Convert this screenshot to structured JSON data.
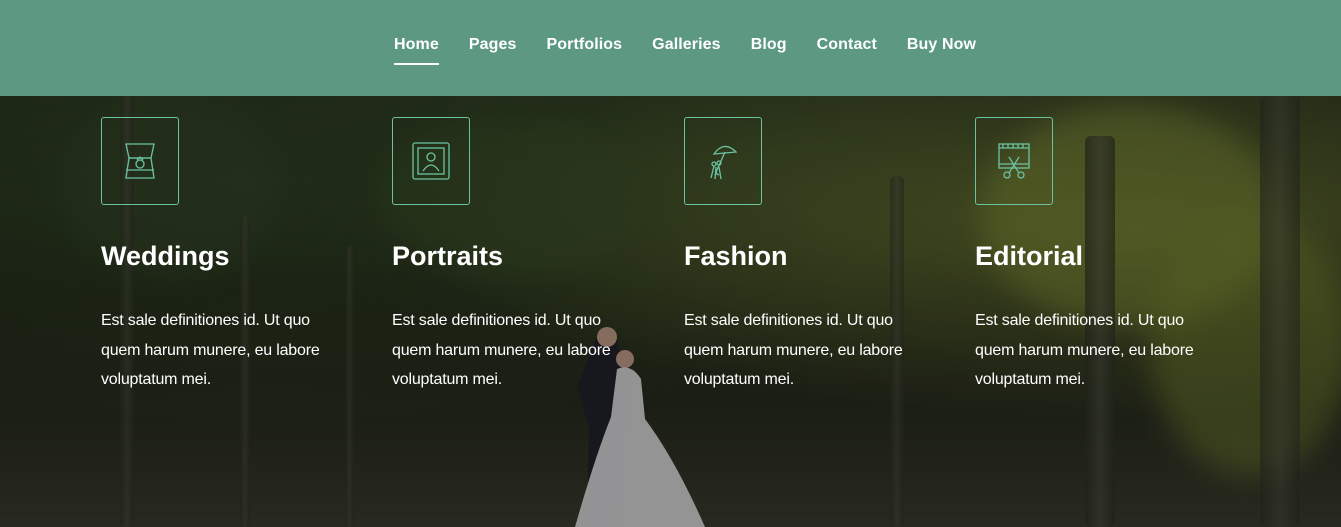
{
  "nav": {
    "items": [
      {
        "label": "Home",
        "active": true
      },
      {
        "label": "Pages",
        "active": false
      },
      {
        "label": "Portfolios",
        "active": false
      },
      {
        "label": "Galleries",
        "active": false
      },
      {
        "label": "Blog",
        "active": false
      },
      {
        "label": "Contact",
        "active": false
      },
      {
        "label": "Buy Now",
        "active": false
      }
    ]
  },
  "colors": {
    "header_bg": "#5c9882",
    "icon_border": "#6cc3a2",
    "text": "#ffffff"
  },
  "services": [
    {
      "icon": "ring-box-icon",
      "title": "Weddings",
      "text": "Est sale definitiones id. Ut quo quem harum munere, eu labore voluptatum mei."
    },
    {
      "icon": "portrait-frame-icon",
      "title": "Portraits",
      "text": "Est sale definitiones id. Ut quo quem harum munere, eu labore voluptatum mei."
    },
    {
      "icon": "umbrella-bouquet-icon",
      "title": "Fashion",
      "text": "Est sale definitiones id. Ut quo quem harum munere, eu labore voluptatum mei."
    },
    {
      "icon": "film-scissors-icon",
      "title": "Editorial",
      "text": "Est sale definitiones id. Ut quo quem harum munere, eu labore voluptatum mei."
    }
  ]
}
